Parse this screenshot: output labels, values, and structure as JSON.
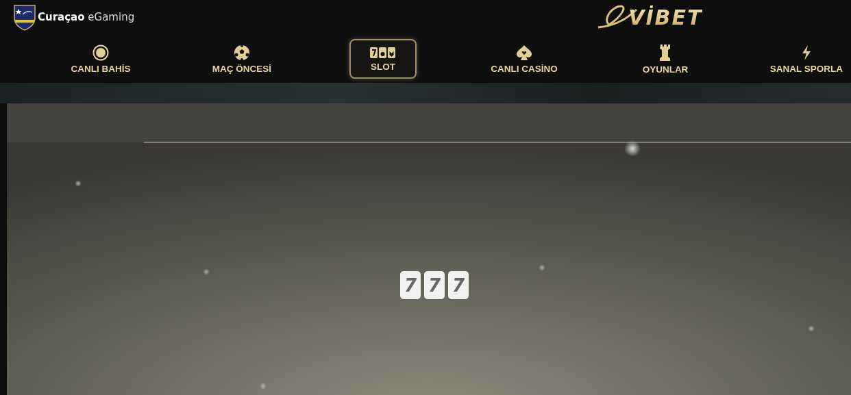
{
  "header": {
    "license": {
      "brand": "Curaçao",
      "suffix": "eGaming"
    },
    "logo": "VİBET"
  },
  "nav": [
    {
      "label": "CANLI BAHİS",
      "kind": "live",
      "selected": false
    },
    {
      "label": "MAÇ ÖNCESİ",
      "kind": "ball",
      "selected": false
    },
    {
      "label": "SLOT",
      "kind": "slot",
      "selected": true
    },
    {
      "label": "CANLI CASİNO",
      "kind": "spade",
      "selected": false
    },
    {
      "label": "OYUNLAR",
      "kind": "rook",
      "selected": false
    },
    {
      "label": "SANAL SPORLA",
      "kind": "bolt",
      "selected": false
    }
  ],
  "loader": {
    "digits": [
      "7",
      "7",
      "7"
    ]
  }
}
